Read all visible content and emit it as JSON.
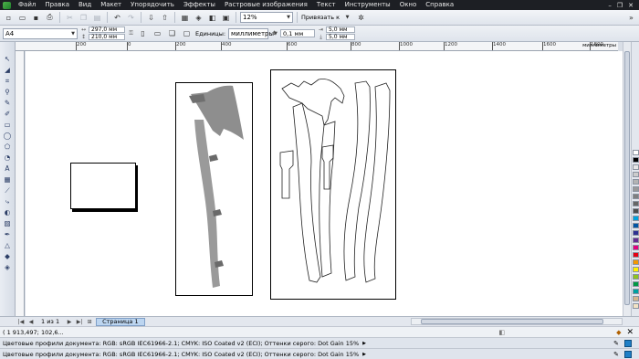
{
  "menu": {
    "items": [
      "Файл",
      "Правка",
      "Вид",
      "Макет",
      "Упорядочить",
      "Эффекты",
      "Растровые изображения",
      "Текст",
      "Инструменты",
      "Окно",
      "Справка"
    ],
    "window_controls": [
      "–",
      "❐",
      "✕"
    ]
  },
  "toolbar": {
    "zoom_value": "12%",
    "snap_label": "Привязать к"
  },
  "propbar": {
    "page_size": "A4",
    "width": "297,0 мм",
    "height": "210,0 мм",
    "units_label": "Единицы:",
    "units_value": "миллиметры",
    "nudge": "0,1 мм",
    "dup_x": "5,0 мм",
    "dup_y": "5,0 мм"
  },
  "ruler": {
    "ticks": [
      "200",
      "0",
      "200",
      "400",
      "600",
      "800",
      "1000",
      "1200",
      "1400",
      "1600",
      "1800"
    ],
    "unit": "миллиметры"
  },
  "pages": {
    "counter": "1 из 1",
    "tab_label": "Страница 1"
  },
  "status": {
    "coords": "( 1 913,497; 102,6...",
    "profiles_1": "Цветовые профили документа: RGB: sRGB IEC61966-2.1; CMYK: ISO Coated v2 (ECI); Оттенки серого: Dot Gain 15%",
    "profiles_2": "Цветовые профили документа: RGB: sRGB IEC61966-2.1; CMYK: ISO Coated v2 (ECI); Оттенки серого: Dot Gain 15%"
  },
  "palette_colors": [
    "#ffffff",
    "#000000",
    "#e6e6e6",
    "#cccccc",
    "#b3b3b3",
    "#999999",
    "#7f7f7f",
    "#666666",
    "#4d4d4d",
    "#00a3e0",
    "#0055a4",
    "#2e3192",
    "#662d91",
    "#e4007f",
    "#e60012",
    "#f39800",
    "#fff100",
    "#8fc31f",
    "#009944",
    "#00a0a0",
    "#d7b68b",
    "#f2e3c4",
    "#c7a6d8",
    "#f8c9d4",
    "#a8d8ea",
    "#b7e3c0",
    "#ffe8a8",
    "#e0e0e0"
  ]
}
